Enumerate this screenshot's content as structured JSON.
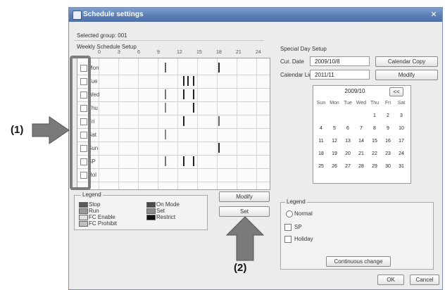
{
  "window": {
    "title": "Schedule settings",
    "close_glyph": "✕",
    "selected_info": "Selected group: 001"
  },
  "weekly": {
    "header": "Weekly Schedule Setup",
    "hours": [
      "0",
      "3",
      "6",
      "9",
      "12",
      "15",
      "18",
      "21",
      "24"
    ],
    "days": [
      "Mon",
      "Tue",
      "Wed",
      "Thu",
      "Fri",
      "Sat",
      "Sun",
      "SP",
      "Hol"
    ]
  },
  "pattern_legend": {
    "header": "Legend",
    "items": [
      {
        "label": "Stop",
        "color": "#5a5a5a"
      },
      {
        "label": "Run",
        "color": "#9a9a9a"
      },
      {
        "label": "FC Enable",
        "color": "#e0e0e0"
      },
      {
        "label": "FC Prohibit",
        "color": "#c0c0c0"
      },
      {
        "label": "On Mode",
        "color": "#4a4a4a"
      },
      {
        "label": "Set",
        "color": "#8a8a8a"
      },
      {
        "label": "Restrict",
        "color": "#111111"
      }
    ]
  },
  "buttons": {
    "modify": "Modify",
    "set": "Set",
    "calendar": "Calendar Copy",
    "modify2": "Modify",
    "continuous": "Continuous change",
    "ok": "OK",
    "cancel": "Cancel"
  },
  "special": {
    "header": "Special Day Setup",
    "current_label": "Cur. Date",
    "current_value": "2009/10/8",
    "calendar_label": "Calendar Limit",
    "calendar_value": "2011/11"
  },
  "calendar": {
    "month_label": "2009/10",
    "nav": "<<",
    "dow": [
      "Sun",
      "Mon",
      "Tue",
      "Wed",
      "Thu",
      "Fri",
      "Sat"
    ],
    "weeks": [
      [
        "",
        "",
        "",
        "",
        "1",
        "2",
        "3"
      ],
      [
        "4",
        "5",
        "6",
        "7",
        "8",
        "9",
        "10"
      ],
      [
        "11",
        "12",
        "13",
        "14",
        "15",
        "16",
        "17"
      ],
      [
        "18",
        "19",
        "20",
        "21",
        "22",
        "23",
        "24"
      ],
      [
        "25",
        "26",
        "27",
        "28",
        "29",
        "30",
        "31"
      ]
    ]
  },
  "legend2": {
    "header": "Legend",
    "items": [
      "Normal",
      "SP",
      "Holiday"
    ]
  },
  "callouts": {
    "one": "(1)",
    "two": "(2)"
  }
}
